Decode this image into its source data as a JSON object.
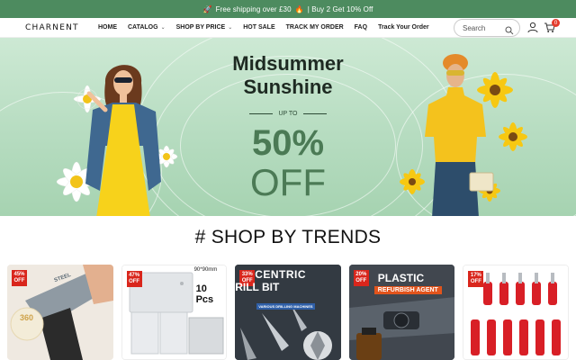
{
  "announcement": {
    "left_icon": "rocket-icon",
    "text_a": "Free shipping over £30",
    "mid_icon": "fire-icon",
    "text_b": "| Buy 2 Get 10% Off"
  },
  "header": {
    "logo": "CHARNENT",
    "nav": [
      {
        "label": "HOME",
        "has_dropdown": false
      },
      {
        "label": "CATALOG",
        "has_dropdown": true
      },
      {
        "label": "SHOP BY PRICE",
        "has_dropdown": true
      },
      {
        "label": "HOT SALE",
        "has_dropdown": false
      },
      {
        "label": "TRACK MY ORDER",
        "has_dropdown": false
      },
      {
        "label": "FAQ",
        "has_dropdown": false
      },
      {
        "label": "Track Your Order",
        "has_dropdown": false
      }
    ],
    "search_placeholder": "Search",
    "cart_count": "0"
  },
  "hero": {
    "title_line1": "Midsummer",
    "title_line2": "Sunshine",
    "upto": "UP TO",
    "percent": "50%",
    "off": "OFF"
  },
  "section": {
    "title": "# SHOP BY TRENDS"
  },
  "products": [
    {
      "badge_pct": "45%",
      "badge_off": "OFF",
      "overlay": "STEEL",
      "overlay2": "360"
    },
    {
      "badge_pct": "47%",
      "badge_off": "OFF",
      "overlay": "90*90mm",
      "overlay2": "10 Pcs"
    },
    {
      "badge_pct": "33%",
      "badge_off": "OFF",
      "overlay": "CENTRIC",
      "overlay2": "RILL BIT",
      "overlay3": "VARIOUS DRILLING MACHINES"
    },
    {
      "badge_pct": "20%",
      "badge_off": "OFF",
      "overlay": "PLASTIC PARTS",
      "overlay2": "REFURBISH AGENT"
    },
    {
      "badge_pct": "17%",
      "badge_off": "OFF"
    }
  ],
  "colors": {
    "announce_bg": "#4d8b5f",
    "accent_green": "#4b7a55",
    "badge_red": "#d9261c"
  }
}
